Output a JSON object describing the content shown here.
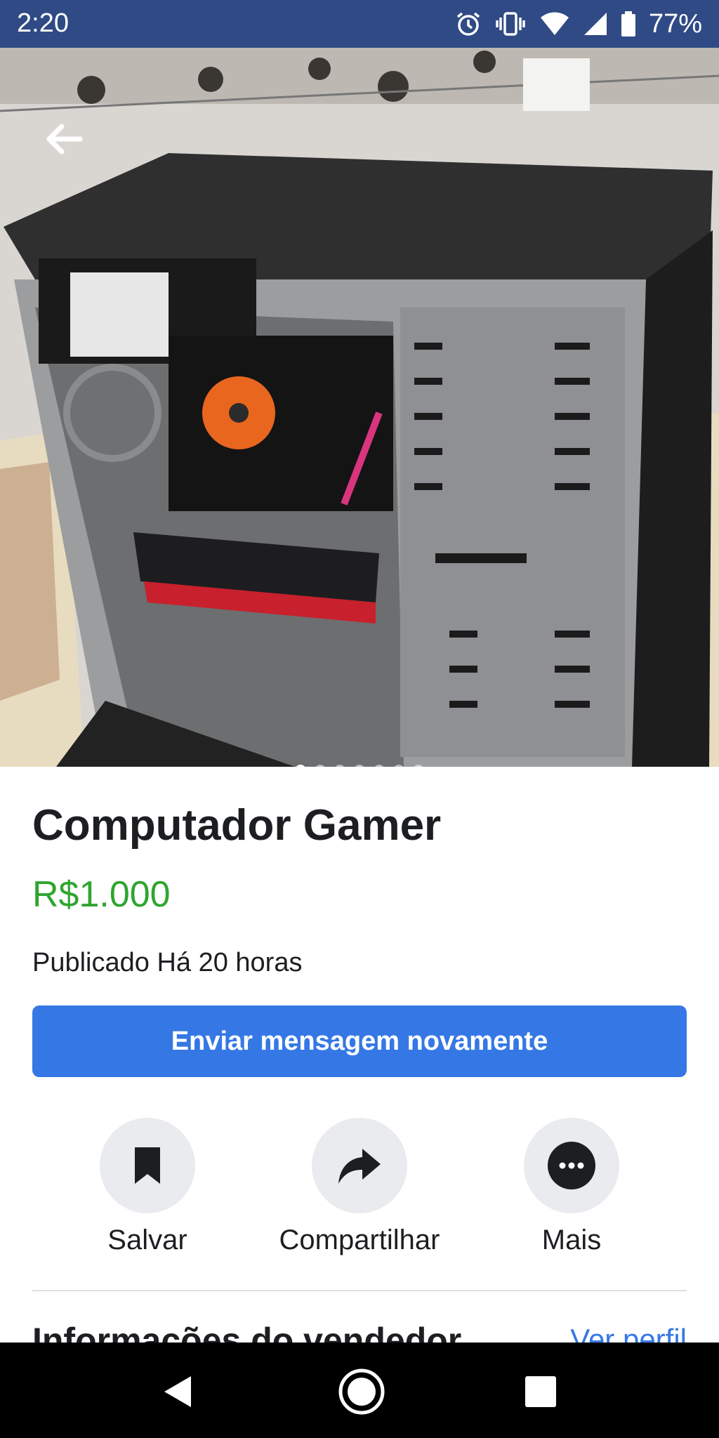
{
  "status_bar": {
    "time": "2:20",
    "battery_percent": "77%",
    "icons": [
      "alarm-icon",
      "vibrate-icon",
      "wifi-icon",
      "signal-icon",
      "battery-icon"
    ]
  },
  "hero": {
    "image_alt": "Foto do computador",
    "image_count": 7,
    "active_index": 0
  },
  "listing": {
    "title": "Computador Gamer",
    "price": "R$1.000",
    "posted": "Publicado Há 20 horas",
    "cta_label": "Enviar mensagem novamente"
  },
  "actions": [
    {
      "label": "Salvar",
      "icon": "bookmark-icon"
    },
    {
      "label": "Compartilhar",
      "icon": "share-icon"
    },
    {
      "label": "Mais",
      "icon": "more-icon"
    }
  ],
  "seller": {
    "section_title": "Informações do vendedor",
    "profile_link": "Ver perfil"
  },
  "colors": {
    "status_bar": "#2f4a85",
    "price": "#2fa52f",
    "primary": "#3578e5",
    "action_circle": "#e9ebee"
  }
}
